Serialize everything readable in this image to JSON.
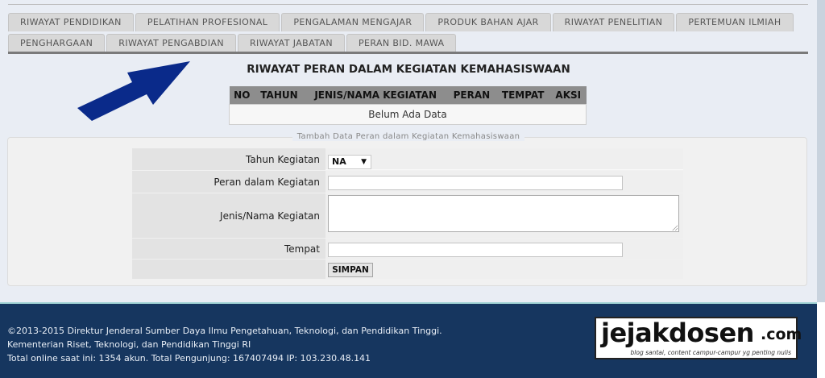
{
  "tabs": {
    "row1": [
      "RIWAYAT PENDIDIKAN",
      "PELATIHAN PROFESIONAL",
      "PENGALAMAN MENGAJAR",
      "PRODUK BAHAN AJAR",
      "RIWAYAT PENELITIAN",
      "PERTEMUAN ILMIAH"
    ],
    "row2": [
      "PENGHARGAAN",
      "RIWAYAT PENGABDIAN",
      "RIWAYAT JABATAN",
      "PERAN BID. MAWA"
    ]
  },
  "section_title": "RIWAYAT PERAN DALAM KEGIATAN KEMAHASISWAAN",
  "table": {
    "headers": [
      "NO",
      "TAHUN",
      "JENIS/NAMA KEGIATAN",
      "PERAN",
      "TEMPAT",
      "AKSI"
    ],
    "empty_message": "Belum Ada Data"
  },
  "form": {
    "legend": "Tambah Data Peran dalam Kegiatan Kemahasiswaan",
    "tahun_label": "Tahun Kegiatan",
    "tahun_value": "NA",
    "peran_label": "Peran dalam Kegiatan",
    "peran_value": "",
    "jenis_label": "Jenis/Nama Kegiatan",
    "jenis_value": "",
    "tempat_label": "Tempat",
    "tempat_value": "",
    "submit_label": "SIMPAN"
  },
  "footer": {
    "line1": "©2013-2015 Direktur Jenderal Sumber Daya Ilmu Pengetahuan, Teknologi, dan Pendidikan Tinggi.",
    "line2": "Kementerian Riset, Teknologi, dan Pendidikan Tinggi RI",
    "line3": "Total online saat ini: 1354 akun. Total Pengunjung: 167407494 IP: 103.230.48.141"
  },
  "watermark": {
    "main": "jejakdosen",
    "tld": ".com",
    "tagline": "blog santai, content campur-campur yg penting nulis"
  },
  "colors": {
    "page_bg": "#e9edf4",
    "footer_bg": "#16365f",
    "arrow": "#0a2a8a",
    "tab_bg": "#d8d8d8",
    "table_header": "#8d8d8d"
  },
  "icons": {
    "annotation_arrow": "arrow-up-right-icon",
    "select_caret": "caret-down-icon",
    "resize_grip": "resize-grip-icon"
  }
}
